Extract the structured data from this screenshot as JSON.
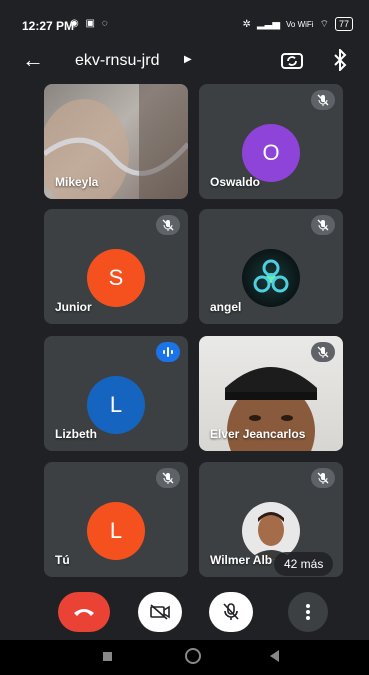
{
  "status_bar": {
    "time": "12:27 PM",
    "left_icons": [
      "whatsapp-icon",
      "message-icon",
      "app-icon"
    ],
    "network_label": "Vo WiFi",
    "battery": "77"
  },
  "app_bar": {
    "meeting_code": "ekv-rnsu-jrd"
  },
  "participants": [
    {
      "name": "Mikeyla",
      "type": "video",
      "muted": false
    },
    {
      "name": "Oswaldo",
      "type": "avatar",
      "initial": "O",
      "color": "#8e44d8",
      "muted": true
    },
    {
      "name": "Junior",
      "type": "avatar",
      "initial": "S",
      "color": "#f4511e",
      "muted": true
    },
    {
      "name": "angel",
      "type": "avatar-image",
      "muted": true
    },
    {
      "name": "Lizbeth",
      "type": "avatar",
      "initial": "L",
      "color": "#1565c0",
      "muted": false,
      "speaking": true
    },
    {
      "name": "Elver Jeancarlos",
      "type": "video",
      "muted": true
    },
    {
      "name": "Tú",
      "type": "avatar",
      "initial": "L",
      "color": "#f4511e",
      "muted": true
    },
    {
      "name": "Wilmer Alb",
      "type": "avatar-image",
      "muted": true
    }
  ],
  "more_participants": "42 más",
  "controls": {
    "end_call": "end-call-icon",
    "camera": "camera-off-icon",
    "mic": "mic-off-icon",
    "more": "more-vertical-icon"
  },
  "colors": {
    "background": "#202124",
    "tile": "#3c4043",
    "end_call": "#ea4335",
    "speaking": "#1a73e8"
  }
}
